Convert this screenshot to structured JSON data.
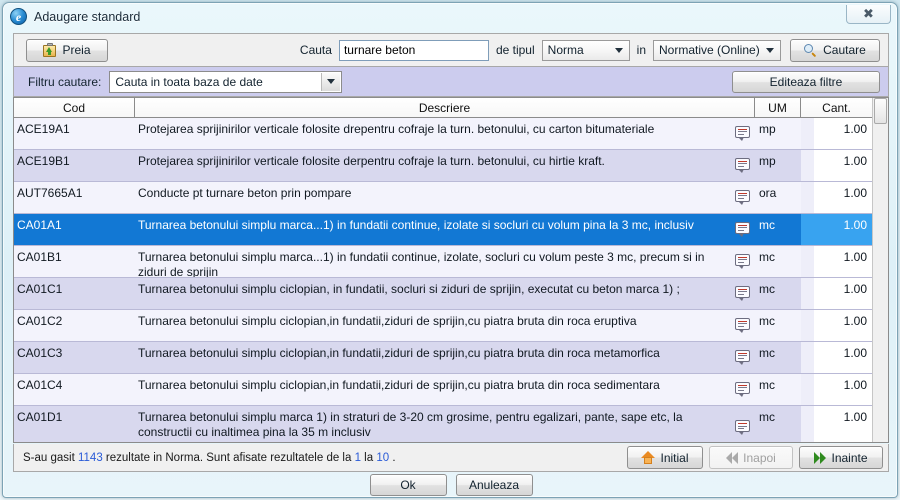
{
  "window": {
    "title": "Adaugare standard",
    "app_icon": "internet-explorer-e-icon",
    "close_label": "✖"
  },
  "toolbar": {
    "preia_label": "Preia",
    "cauta_label": "Cauta",
    "search_value": "turnare beton",
    "search_placeholder": "",
    "de_tipul_label": "de tipul",
    "tip_value": "Norma",
    "in_label": "in",
    "sursa_value": "Normative (Online)",
    "cautare_label": "Cautare"
  },
  "filterbar": {
    "filtru_label": "Filtru cautare:",
    "filtru_value": "Cauta in toata baza de date",
    "editeaza_label": "Editeaza filtre"
  },
  "table": {
    "columns": [
      "Cod",
      "Descriere",
      "UM",
      "Cant."
    ],
    "rows": [
      {
        "cod": "ACE19A1",
        "descriere": "Protejarea sprijinirilor verticale folosite drepentru cofraje la turn. betonului, cu carton bitumateriale",
        "um": "mp",
        "cant": "1.00",
        "selected": false
      },
      {
        "cod": "ACE19B1",
        "descriere": "Protejarea sprijinirilor verticale folosite derpentru cofraje la turn. betonului, cu hirtie kraft.",
        "um": "mp",
        "cant": "1.00",
        "selected": false
      },
      {
        "cod": "AUT7665A1",
        "descriere": "Conducte pt turnare beton prin pompare",
        "um": "ora",
        "cant": "1.00",
        "selected": false
      },
      {
        "cod": "CA01A1",
        "descriere": "Turnarea betonului simplu marca...1) in fundatii continue, izolate si socluri cu volum pina la 3 mc, inclusiv",
        "um": "mc",
        "cant": "1.00",
        "selected": true
      },
      {
        "cod": "CA01B1",
        "descriere": "Turnarea betonului simplu marca...1) in fundatii continue, izolate, socluri cu volum peste 3 mc, precum si in ziduri de sprijin",
        "um": "mc",
        "cant": "1.00",
        "selected": false
      },
      {
        "cod": "CA01C1",
        "descriere": "Turnarea betonului simplu ciclopian, in fundatii, socluri si ziduri de sprijin, executat cu beton marca 1) ;",
        "um": "mc",
        "cant": "1.00",
        "selected": false
      },
      {
        "cod": "CA01C2",
        "descriere": "Turnarea betonului simplu ciclopian,in fundatii,ziduri de sprijin,cu piatra bruta din roca eruptiva",
        "um": "mc",
        "cant": "1.00",
        "selected": false
      },
      {
        "cod": "CA01C3",
        "descriere": "Turnarea betonului simplu ciclopian,in fundatii,ziduri de sprijin,cu piatra bruta din roca metamorfica",
        "um": "mc",
        "cant": "1.00",
        "selected": false
      },
      {
        "cod": "CA01C4",
        "descriere": "Turnarea betonului simplu ciclopian,in fundatii,ziduri de sprijin,cu piatra bruta din roca sedimentara",
        "um": "mc",
        "cant": "1.00",
        "selected": false
      },
      {
        "cod": "CA01D1",
        "descriere": "Turnarea betonului simplu marca 1) in straturi de 3-20 cm grosime, pentru egalizari, pante, sape etc, la constructii cu inaltimea pina la 35 m inclusiv",
        "um": "mc",
        "cant": "1.00",
        "selected": false
      }
    ]
  },
  "status": {
    "prefix": "S-au gasit ",
    "count": "1143",
    "middle": " rezultate in Norma. Sunt afisate rezultatele de la ",
    "from": "1",
    "between": " la ",
    "to": "10",
    "suffix": " .",
    "initial_label": "Initial",
    "inapoi_label": "Inapoi",
    "inainte_label": "Inainte"
  },
  "footer": {
    "ok_label": "Ok",
    "anuleaza_label": "Anuleaza"
  },
  "colors": {
    "selection_blue": "#1278d4",
    "selection_cant_blue": "#38a3f0",
    "filter_lavender": "#ccccee",
    "row_alt": "#d8d8ee",
    "link_blue": "#2a5bd7"
  }
}
